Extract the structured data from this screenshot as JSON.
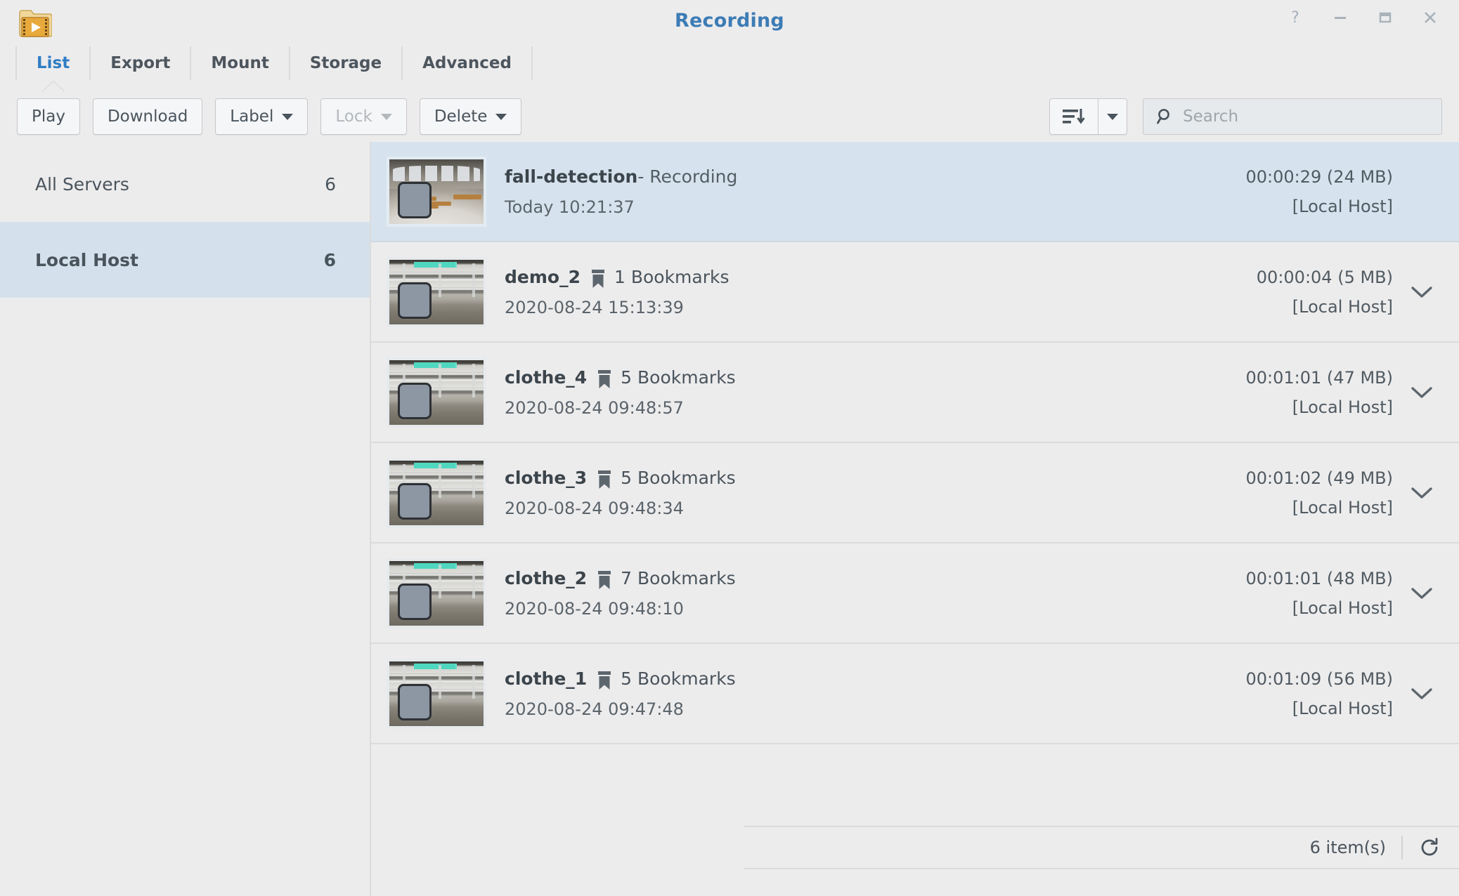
{
  "window": {
    "title": "Recording",
    "app_icon": "video-folder-icon",
    "controls": [
      {
        "name": "help-button",
        "glyph": "?"
      },
      {
        "name": "minimize-button",
        "glyph": "–"
      },
      {
        "name": "maximize-button",
        "glyph": "▭"
      },
      {
        "name": "close-button",
        "glyph": "✕"
      }
    ]
  },
  "tabs": [
    {
      "label": "List",
      "active": true
    },
    {
      "label": "Export",
      "active": false
    },
    {
      "label": "Mount",
      "active": false
    },
    {
      "label": "Storage",
      "active": false
    },
    {
      "label": "Advanced",
      "active": false
    }
  ],
  "toolbar": {
    "play_label": "Play",
    "download_label": "Download",
    "label_label": "Label",
    "lock_label": "Lock",
    "delete_label": "Delete",
    "sort_icon": "sort-descending-icon",
    "sort_dropdown_icon": "caret-down-icon",
    "search_icon": "search-icon",
    "search_placeholder": "Search",
    "search_value": ""
  },
  "sidebar": {
    "items": [
      {
        "label": "All Servers",
        "count": "6",
        "active": false
      },
      {
        "label": "Local Host",
        "count": "6",
        "active": true
      }
    ]
  },
  "list": {
    "rows": [
      {
        "name": "fall-detection",
        "suffix": " - Recording",
        "bookmarks": "",
        "timestamp": "Today 10:21:37",
        "duration_size": "00:00:29 (24 MB)",
        "host": "[Local Host]",
        "selected": true,
        "scene": "room",
        "chevron": false
      },
      {
        "name": "demo_2",
        "suffix": "",
        "bookmarks": "1 Bookmarks",
        "timestamp": "2020-08-24 15:13:39",
        "duration_size": "00:00:04 (5 MB)",
        "host": "[Local Host]",
        "selected": false,
        "scene": "corridor",
        "chevron": true
      },
      {
        "name": "clothe_4",
        "suffix": "",
        "bookmarks": "5 Bookmarks",
        "timestamp": "2020-08-24 09:48:57",
        "duration_size": "00:01:01 (47 MB)",
        "host": "[Local Host]",
        "selected": false,
        "scene": "corridor",
        "chevron": true
      },
      {
        "name": "clothe_3",
        "suffix": "",
        "bookmarks": "5 Bookmarks",
        "timestamp": "2020-08-24 09:48:34",
        "duration_size": "00:01:02 (49 MB)",
        "host": "[Local Host]",
        "selected": false,
        "scene": "corridor",
        "chevron": true
      },
      {
        "name": "clothe_2",
        "suffix": "",
        "bookmarks": "7 Bookmarks",
        "timestamp": "2020-08-24 09:48:10",
        "duration_size": "00:01:01 (48 MB)",
        "host": "[Local Host]",
        "selected": false,
        "scene": "corridor",
        "chevron": true
      },
      {
        "name": "clothe_1",
        "suffix": "",
        "bookmarks": "5 Bookmarks",
        "timestamp": "2020-08-24 09:47:48",
        "duration_size": "00:01:09 (56 MB)",
        "host": "[Local Host]",
        "selected": false,
        "scene": "corridor",
        "chevron": true
      }
    ]
  },
  "statusbar": {
    "count_label": "6 item(s)",
    "refresh_icon": "refresh-icon"
  },
  "colors": {
    "accent": "#3d7cb5",
    "window_bg": "#edeced",
    "selection": "#d6e3ee",
    "sidebar_selection": "#d4e1ec",
    "border": "#dcdbdc",
    "text": "#4a545c"
  }
}
